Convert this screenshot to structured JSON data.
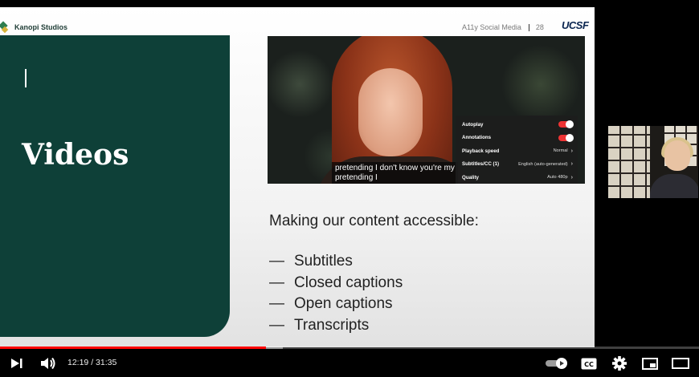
{
  "slide": {
    "brand": "Kanopi Studios",
    "header_text": "A11y Social Media",
    "page_number": "28",
    "logo_text": "UCSF",
    "title": "Videos",
    "heading": "Making our content accessible:",
    "bullets": [
      "Subtitles",
      "Closed captions",
      "Open captions",
      "Transcripts"
    ],
    "bullet_dash": "—"
  },
  "video_still": {
    "caption_line1": "pretending I don't know you're my",
    "caption_line2": "pretending I",
    "settings_menu": [
      {
        "label": "Autoplay",
        "type": "toggle",
        "on": true
      },
      {
        "label": "Annotations",
        "type": "toggle",
        "on": true
      },
      {
        "label": "Playback speed",
        "value": "Normal"
      },
      {
        "label": "Subtitles/CC (1)",
        "value": "English (auto-generated)"
      },
      {
        "label": "Quality",
        "value": "Auto 480p"
      }
    ]
  },
  "player": {
    "current_time": "12:19",
    "duration": "31:35",
    "time_display": "12:19 / 31:35",
    "progress_fraction": 0.38,
    "buffered_fraction": 0.405,
    "accent_color": "#ff0000",
    "cc_label": "CC",
    "icons": [
      "next-icon",
      "volume-icon",
      "autoplay-toggle-icon",
      "subtitles-icon",
      "gear-icon",
      "miniplayer-icon",
      "theater-mode-icon"
    ]
  }
}
